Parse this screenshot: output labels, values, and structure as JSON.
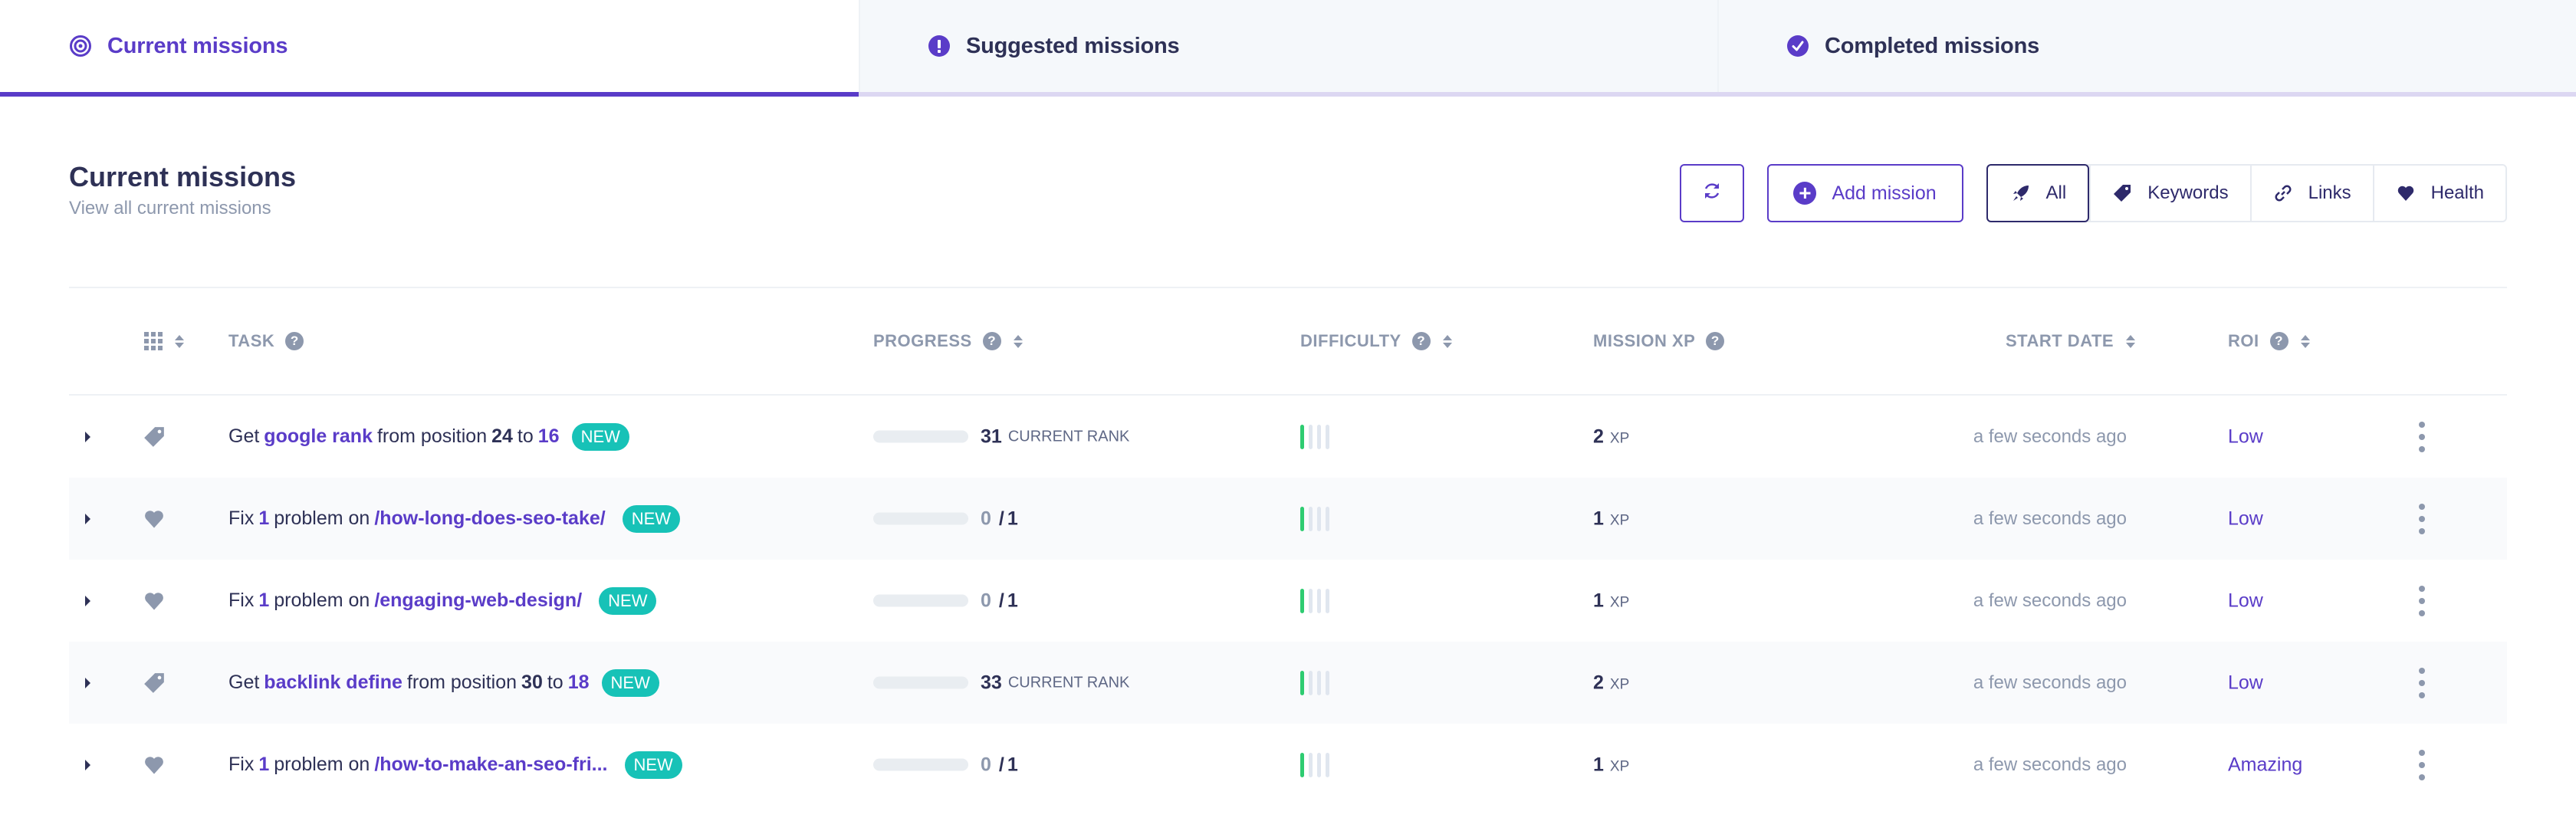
{
  "tabs": [
    {
      "label": "Current missions",
      "icon": "target-icon",
      "active": true
    },
    {
      "label": "Suggested missions",
      "icon": "exclamation-circle-icon",
      "active": false
    },
    {
      "label": "Completed missions",
      "icon": "check-circle-icon",
      "active": false
    }
  ],
  "header": {
    "title": "Current missions",
    "subtitle": "View all current missions"
  },
  "toolbar": {
    "refresh_icon": "refresh-icon",
    "add_label": "Add mission",
    "filters": [
      {
        "label": "All",
        "icon": "rocket-icon",
        "active": true
      },
      {
        "label": "Keywords",
        "icon": "tag-icon",
        "active": false
      },
      {
        "label": "Links",
        "icon": "link-icon",
        "active": false
      },
      {
        "label": "Health",
        "icon": "heart-icon",
        "active": false
      }
    ]
  },
  "table": {
    "columns": {
      "task": "TASK",
      "progress": "PROGRESS",
      "difficulty": "DIFFICULTY",
      "mission_xp": "MISSION XP",
      "start_date": "START DATE",
      "roi": "ROI"
    },
    "rows": [
      {
        "type": "keyword",
        "task": {
          "prefix": "Get",
          "subject": "google rank",
          "middle": "from position",
          "from": "24",
          "to_word": "to",
          "to": "16"
        },
        "badge": "NEW",
        "progress": {
          "value": "31",
          "unit": "CURRENT RANK",
          "fraction": 0
        },
        "difficulty": 1,
        "difficulty_max": 4,
        "xp": "2",
        "xp_unit": "XP",
        "start_date": "a few seconds ago",
        "roi": "Low"
      },
      {
        "type": "health",
        "task": {
          "prefix": "Fix",
          "count": "1",
          "middle": "problem on",
          "path": "/how-long-does-seo-take/"
        },
        "badge": "NEW",
        "progress": {
          "done": "0",
          "total": "1",
          "fraction": 0
        },
        "difficulty": 1,
        "difficulty_max": 4,
        "xp": "1",
        "xp_unit": "XP",
        "start_date": "a few seconds ago",
        "roi": "Low"
      },
      {
        "type": "health",
        "task": {
          "prefix": "Fix",
          "count": "1",
          "middle": "problem on",
          "path": "/engaging-web-design/"
        },
        "badge": "NEW",
        "progress": {
          "done": "0",
          "total": "1",
          "fraction": 0
        },
        "difficulty": 1,
        "difficulty_max": 4,
        "xp": "1",
        "xp_unit": "XP",
        "start_date": "a few seconds ago",
        "roi": "Low"
      },
      {
        "type": "keyword",
        "task": {
          "prefix": "Get",
          "subject": "backlink define",
          "middle": "from position",
          "from": "30",
          "to_word": "to",
          "to": "18"
        },
        "badge": "NEW",
        "progress": {
          "value": "33",
          "unit": "CURRENT RANK",
          "fraction": 0
        },
        "difficulty": 1,
        "difficulty_max": 4,
        "xp": "2",
        "xp_unit": "XP",
        "start_date": "a few seconds ago",
        "roi": "Low"
      },
      {
        "type": "health",
        "task": {
          "prefix": "Fix",
          "count": "1",
          "middle": "problem on",
          "path": "/how-to-make-an-seo-fri..."
        },
        "badge": "NEW",
        "progress": {
          "done": "0",
          "total": "1",
          "fraction": 0
        },
        "difficulty": 1,
        "difficulty_max": 4,
        "xp": "1",
        "xp_unit": "XP",
        "start_date": "a few seconds ago",
        "roi": "Amazing"
      }
    ]
  },
  "colors": {
    "accent": "#5a3cc8",
    "text": "#2e3156",
    "muted": "#8d98ad",
    "badge": "#17c2b7",
    "difficulty_on": "#2ecc71"
  }
}
